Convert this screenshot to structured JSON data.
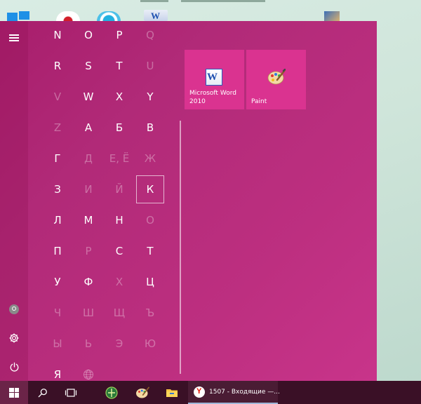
{
  "start_menu": {
    "letters": [
      {
        "char": "N",
        "enabled": true
      },
      {
        "char": "O",
        "enabled": true
      },
      {
        "char": "P",
        "enabled": true
      },
      {
        "char": "Q",
        "enabled": false
      },
      {
        "char": "R",
        "enabled": true
      },
      {
        "char": "S",
        "enabled": true
      },
      {
        "char": "T",
        "enabled": true
      },
      {
        "char": "U",
        "enabled": false
      },
      {
        "char": "V",
        "enabled": false
      },
      {
        "char": "W",
        "enabled": true
      },
      {
        "char": "X",
        "enabled": true
      },
      {
        "char": "Y",
        "enabled": true
      },
      {
        "char": "Z",
        "enabled": false
      },
      {
        "char": "А",
        "enabled": true
      },
      {
        "char": "Б",
        "enabled": true
      },
      {
        "char": "В",
        "enabled": true
      },
      {
        "char": "Г",
        "enabled": true
      },
      {
        "char": "Д",
        "enabled": false
      },
      {
        "char": "Е, Ё",
        "enabled": false
      },
      {
        "char": "Ж",
        "enabled": false
      },
      {
        "char": "З",
        "enabled": true
      },
      {
        "char": "И",
        "enabled": false
      },
      {
        "char": "Й",
        "enabled": false
      },
      {
        "char": "К",
        "enabled": true,
        "focused": true
      },
      {
        "char": "Л",
        "enabled": true
      },
      {
        "char": "М",
        "enabled": true
      },
      {
        "char": "Н",
        "enabled": true
      },
      {
        "char": "О",
        "enabled": false
      },
      {
        "char": "П",
        "enabled": true
      },
      {
        "char": "Р",
        "enabled": false
      },
      {
        "char": "С",
        "enabled": true
      },
      {
        "char": "Т",
        "enabled": true
      },
      {
        "char": "У",
        "enabled": true
      },
      {
        "char": "Ф",
        "enabled": true
      },
      {
        "char": "Х",
        "enabled": false
      },
      {
        "char": "Ц",
        "enabled": true
      },
      {
        "char": "Ч",
        "enabled": false
      },
      {
        "char": "Ш",
        "enabled": false
      },
      {
        "char": "Щ",
        "enabled": false
      },
      {
        "char": "Ъ",
        "enabled": false
      },
      {
        "char": "Ы",
        "enabled": false
      },
      {
        "char": "Ь",
        "enabled": false
      },
      {
        "char": "Э",
        "enabled": false
      },
      {
        "char": "Ю",
        "enabled": false
      },
      {
        "char": "Я",
        "enabled": true
      },
      {
        "char": "",
        "enabled": false,
        "icon": "globe-icon"
      }
    ],
    "tiles": {
      "word_label": "Microsoft Word 2010",
      "paint_label": "Paint"
    },
    "rail_icons": [
      "hamburger-icon",
      "avatar-icon",
      "gear-icon",
      "power-icon"
    ]
  },
  "taskbar": {
    "yandex_label": "1507 - Входящие —..."
  },
  "colors": {
    "menu_bg": "#b12a78",
    "tile_bg": "#da3390",
    "taskbar_bg": "#3a1026",
    "start_button_bg": "#6b2448"
  }
}
